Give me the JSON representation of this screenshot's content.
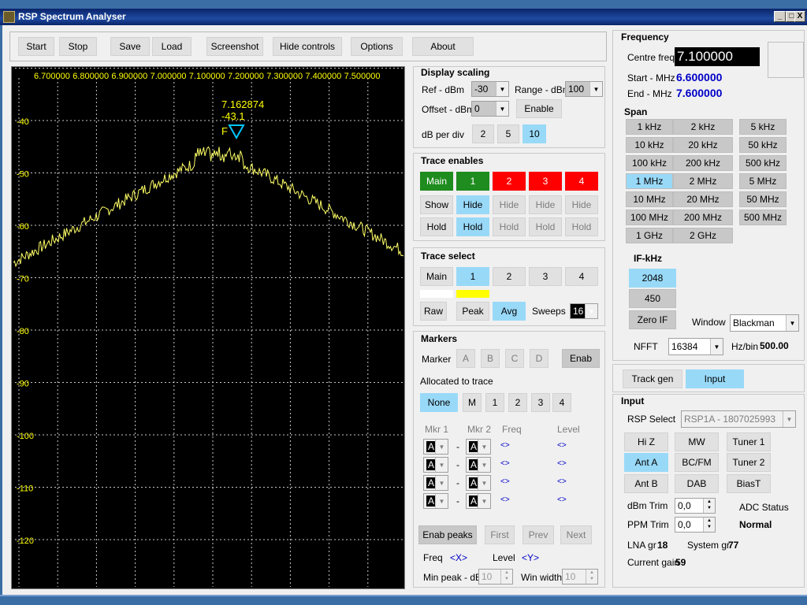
{
  "window": {
    "title": "RSP Spectrum Analyser",
    "min": "_",
    "max": "□",
    "close": "X"
  },
  "toolbar": {
    "start": "Start",
    "stop": "Stop",
    "save": "Save",
    "load": "Load",
    "screenshot": "Screenshot",
    "hide_controls": "Hide controls",
    "options": "Options",
    "about": "About"
  },
  "plot": {
    "freq_labels": [
      "6.700000",
      "6.800000",
      "6.900000",
      "7.000000",
      "7.100000",
      "7.200000",
      "7.300000",
      "7.400000",
      "7.500000"
    ],
    "db_labels": [
      "-40",
      "-50",
      "-60",
      "-70",
      "-80",
      "-90",
      "-100",
      "-110",
      "-120"
    ],
    "marker_freq": "7.162874",
    "marker_level": "-43.1",
    "marker_letter": "F",
    "trace_color": "#ffff66",
    "grid_color": "#c8c8c8",
    "label_color": "#ffff00",
    "marker_color": "#00c8ff"
  },
  "display_scaling": {
    "title": "Display scaling",
    "ref_label": "Ref - dBm",
    "ref_value": "-30",
    "range_label": "Range - dBm",
    "range_value": "100",
    "offset_label": "Offset - dBm",
    "offset_value": "0",
    "enable": "Enable",
    "dbdiv_label": "dB per div",
    "dbdiv": [
      "2",
      "5",
      "10"
    ]
  },
  "trace_enables": {
    "title": "Trace enables",
    "traces": [
      "Main",
      "1",
      "2",
      "3",
      "4"
    ],
    "show": "Show",
    "hide": "Hide",
    "hold": "Hold"
  },
  "trace_select": {
    "title": "Trace select",
    "traces": [
      "Main",
      "1",
      "2",
      "3",
      "4"
    ],
    "raw": "Raw",
    "peak": "Peak",
    "avg": "Avg",
    "sweeps_label": "Sweeps",
    "sweeps_value": "16"
  },
  "markers": {
    "title": "Markers",
    "marker_label": "Marker",
    "marker_btns": [
      "A",
      "B",
      "C",
      "D"
    ],
    "enab": "Enab",
    "allocated_label": "Allocated to trace",
    "alloc_btns": [
      "None",
      "M",
      "1",
      "2",
      "3",
      "4"
    ],
    "col_mkr1": "Mkr 1",
    "col_mkr2": "Mkr 2",
    "col_freq": "Freq",
    "col_level": "Level",
    "row_val": "A",
    "dash": "-",
    "empty": "<>",
    "enab_peaks": "Enab peaks",
    "first": "First",
    "prev": "Prev",
    "next": "Next",
    "freq_label": "Freq",
    "freq_var": "<X>",
    "level_label": "Level",
    "level_var": "<Y>",
    "min_peak_label": "Min peak - dB",
    "min_peak_value": "10",
    "win_width_label": "Win width",
    "win_width_value": "10"
  },
  "frequency": {
    "title": "Frequency",
    "centre_label": "Centre freq",
    "centre_value": "7.100000",
    "start_label": "Start - MHz",
    "start_value": "6.600000",
    "end_label": "End - MHz",
    "end_value": "7.600000",
    "span_title": "Span",
    "span": [
      "1 kHz",
      "2 kHz",
      "5 kHz",
      "10 kHz",
      "20 kHz",
      "50 kHz",
      "100 kHz",
      "200 kHz",
      "500 kHz",
      "1 MHz",
      "2 MHz",
      "5 MHz",
      "10 MHz",
      "20 MHz",
      "50 MHz",
      "100 MHz",
      "200 MHz",
      "500 MHz",
      "1 GHz",
      "2 GHz"
    ],
    "if_title": "IF-kHz",
    "if_values": [
      "2048",
      "450"
    ],
    "zero_if": "Zero IF",
    "window_label": "Window",
    "window_value": "Blackman",
    "nfft_label": "NFFT",
    "nfft_value": "16384",
    "hzbin_label": "Hz/bin",
    "hzbin_value": "500.00"
  },
  "tabs": {
    "track_gen": "Track gen",
    "input": "Input"
  },
  "input": {
    "title": "Input",
    "rsp_label": "RSP Select",
    "rsp_value": "RSP1A - 1807025993",
    "hiz": "Hi Z",
    "mw": "MW",
    "tuner1": "Tuner 1",
    "ant_a": "Ant A",
    "bcfm": "BC/FM",
    "tuner2": "Tuner 2",
    "ant_b": "Ant B",
    "dab": "DAB",
    "biast": "BiasT",
    "dbm_trim_label": "dBm Trim",
    "dbm_trim_value": "0,0",
    "ppm_trim_label": "PPM Trim",
    "ppm_trim_value": "0,0",
    "adc_label": "ADC Status",
    "adc_value": "Normal",
    "lna_label": "LNA gr",
    "lna_value": "18",
    "sysgr_label": "System gr",
    "sysgr_value": "77",
    "gain_label": "Current gain",
    "gain_value": "59"
  }
}
